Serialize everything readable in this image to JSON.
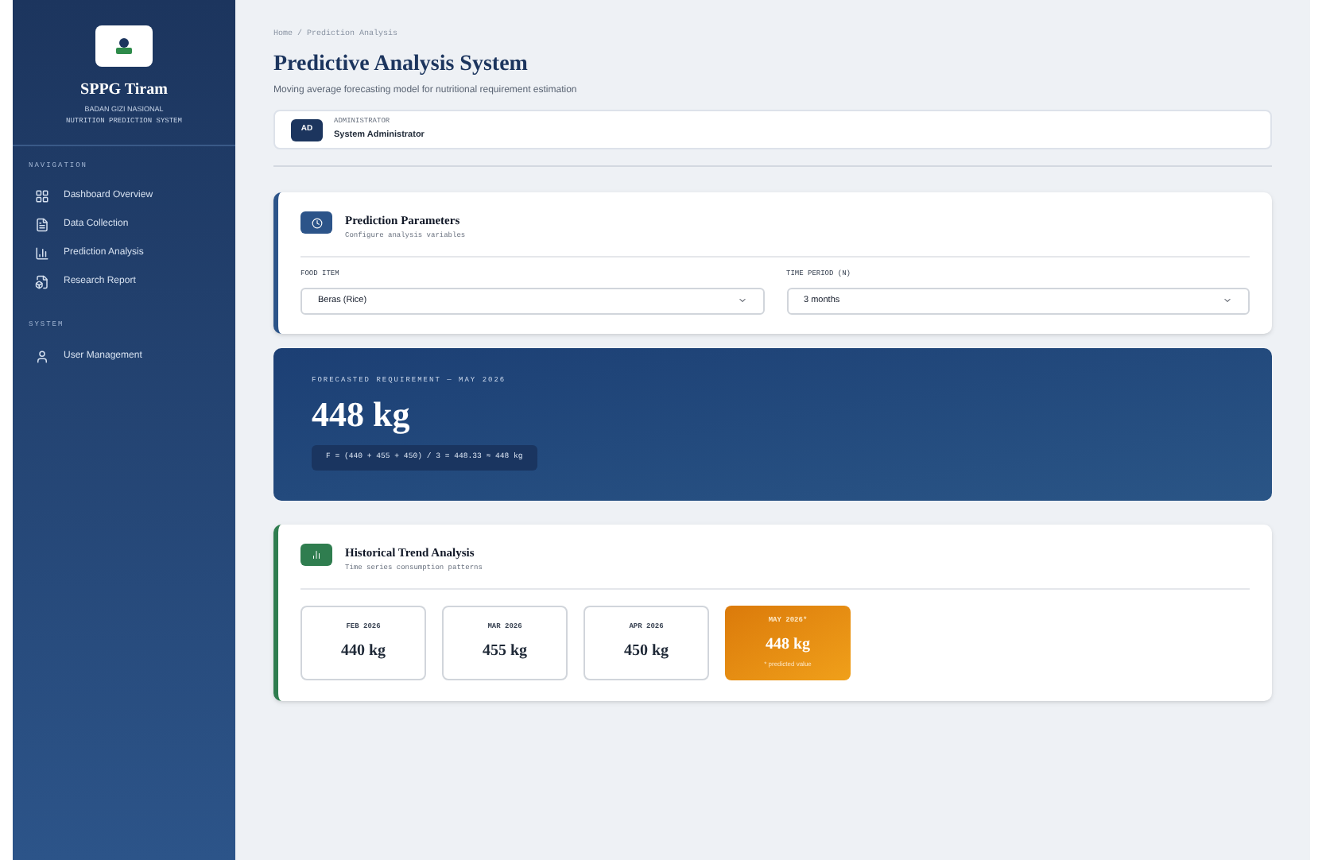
{
  "sidebar": {
    "brand": "SPPG Tiram",
    "subtitle": "BADAN GIZI NASIONAL",
    "tagline": "NUTRITION PREDICTION SYSTEM",
    "sections": [
      {
        "heading": "NAVIGATION",
        "items": [
          {
            "label": "Dashboard Overview",
            "kind": "grid"
          },
          {
            "label": "Data Collection",
            "kind": "file"
          },
          {
            "label": "Prediction Analysis",
            "kind": "bars"
          },
          {
            "label": "Research Report",
            "kind": "doc"
          }
        ]
      },
      {
        "heading": "SYSTEM",
        "items": [
          {
            "label": "User Management",
            "kind": "user"
          }
        ]
      }
    ]
  },
  "breadcrumb": "Home / Prediction Analysis",
  "title": "Predictive Analysis System",
  "subtitle": "Moving average forecasting model for nutritional requirement estimation",
  "user": {
    "initials": "AD",
    "role": "ADMINISTRATOR",
    "name": "System Administrator"
  },
  "parameters": {
    "title": "Prediction Parameters",
    "subtitle": "Configure analysis variables",
    "fields": [
      {
        "label": "FOOD ITEM",
        "value": "Beras (Rice)"
      },
      {
        "label": "TIME PERIOD (N)",
        "value": "3 months"
      }
    ]
  },
  "forecast": {
    "label": "FORECASTED REQUIREMENT — MAY 2026",
    "value": "448 kg",
    "formula": "F = (440 + 455 + 450) / 3 = 448.33 ≈ 448 kg"
  },
  "trend": {
    "title": "Historical Trend Analysis",
    "subtitle": "Time series consumption patterns",
    "cards": [
      {
        "kind": "actual",
        "month": "FEB 2026",
        "value": "440 kg"
      },
      {
        "kind": "actual",
        "month": "MAR 2026",
        "value": "455 kg"
      },
      {
        "kind": "actual",
        "month": "APR 2026",
        "value": "450 kg"
      },
      {
        "kind": "predicted",
        "month": "MAY 2026*",
        "value": "448 kg",
        "note": "* predicted value"
      }
    ]
  }
}
